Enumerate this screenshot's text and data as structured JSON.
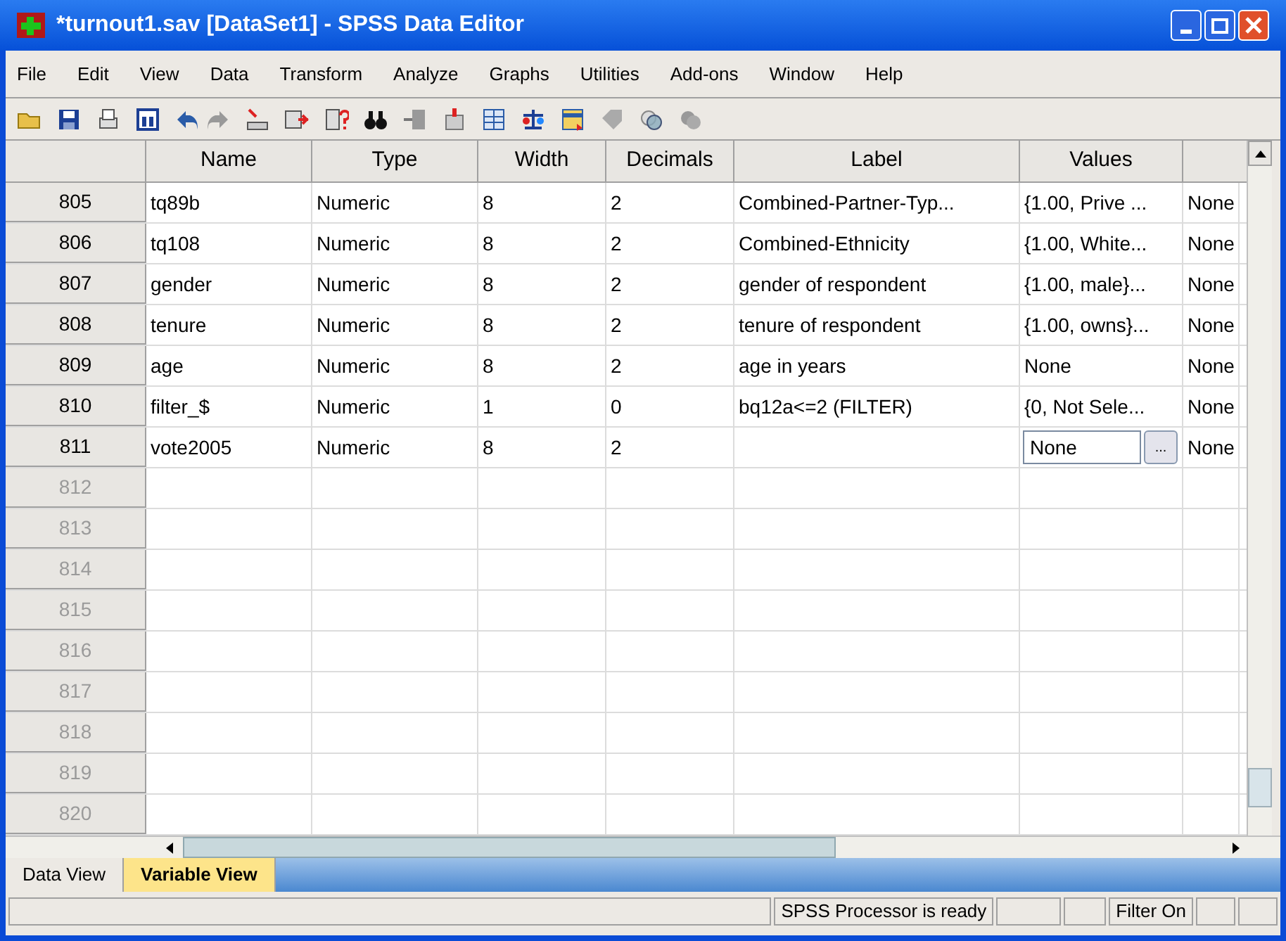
{
  "window": {
    "title": "*turnout1.sav [DataSet1] - SPSS Data Editor"
  },
  "menu": [
    "File",
    "Edit",
    "View",
    "Data",
    "Transform",
    "Analyze",
    "Graphs",
    "Utilities",
    "Add-ons",
    "Window",
    "Help"
  ],
  "table": {
    "columns": [
      "Name",
      "Type",
      "Width",
      "Decimals",
      "Label",
      "Values"
    ],
    "rows": [
      {
        "number": "805",
        "cells": [
          "tq89b",
          "Numeric",
          "8",
          "2",
          "Combined-Partner-Typ...",
          "{1.00, Prive ...",
          "None"
        ]
      },
      {
        "number": "806",
        "cells": [
          "tq108",
          "Numeric",
          "8",
          "2",
          "Combined-Ethnicity",
          "{1.00, White...",
          "None"
        ]
      },
      {
        "number": "807",
        "cells": [
          "gender",
          "Numeric",
          "8",
          "2",
          "gender of respondent",
          "{1.00, male}...",
          "None"
        ]
      },
      {
        "number": "808",
        "cells": [
          "tenure",
          "Numeric",
          "8",
          "2",
          "tenure of respondent",
          "{1.00, owns}...",
          "None"
        ]
      },
      {
        "number": "809",
        "cells": [
          "age",
          "Numeric",
          "8",
          "2",
          "age in years",
          "None",
          "None"
        ]
      },
      {
        "number": "810",
        "cells": [
          "filter_$",
          "Numeric",
          "1",
          "0",
          "bq12a<=2 (FILTER)",
          "{0, Not Sele...",
          "None"
        ]
      },
      {
        "number": "811",
        "cells": [
          "vote2005",
          "Numeric",
          "8",
          "2",
          "",
          "",
          "None"
        ],
        "editor": {
          "value": "None",
          "button": "..."
        }
      },
      {
        "number": "812",
        "cells": []
      },
      {
        "number": "813",
        "cells": []
      },
      {
        "number": "814",
        "cells": []
      },
      {
        "number": "815",
        "cells": []
      },
      {
        "number": "816",
        "cells": []
      },
      {
        "number": "817",
        "cells": []
      },
      {
        "number": "818",
        "cells": []
      },
      {
        "number": "819",
        "cells": []
      },
      {
        "number": "820",
        "cells": []
      }
    ]
  },
  "tabs": [
    {
      "label": "Data View",
      "selected": false
    },
    {
      "label": "Variable View",
      "selected": true
    }
  ],
  "status_bar": {
    "processor": "SPSS  Processor is ready",
    "filter": "Filter On"
  }
}
